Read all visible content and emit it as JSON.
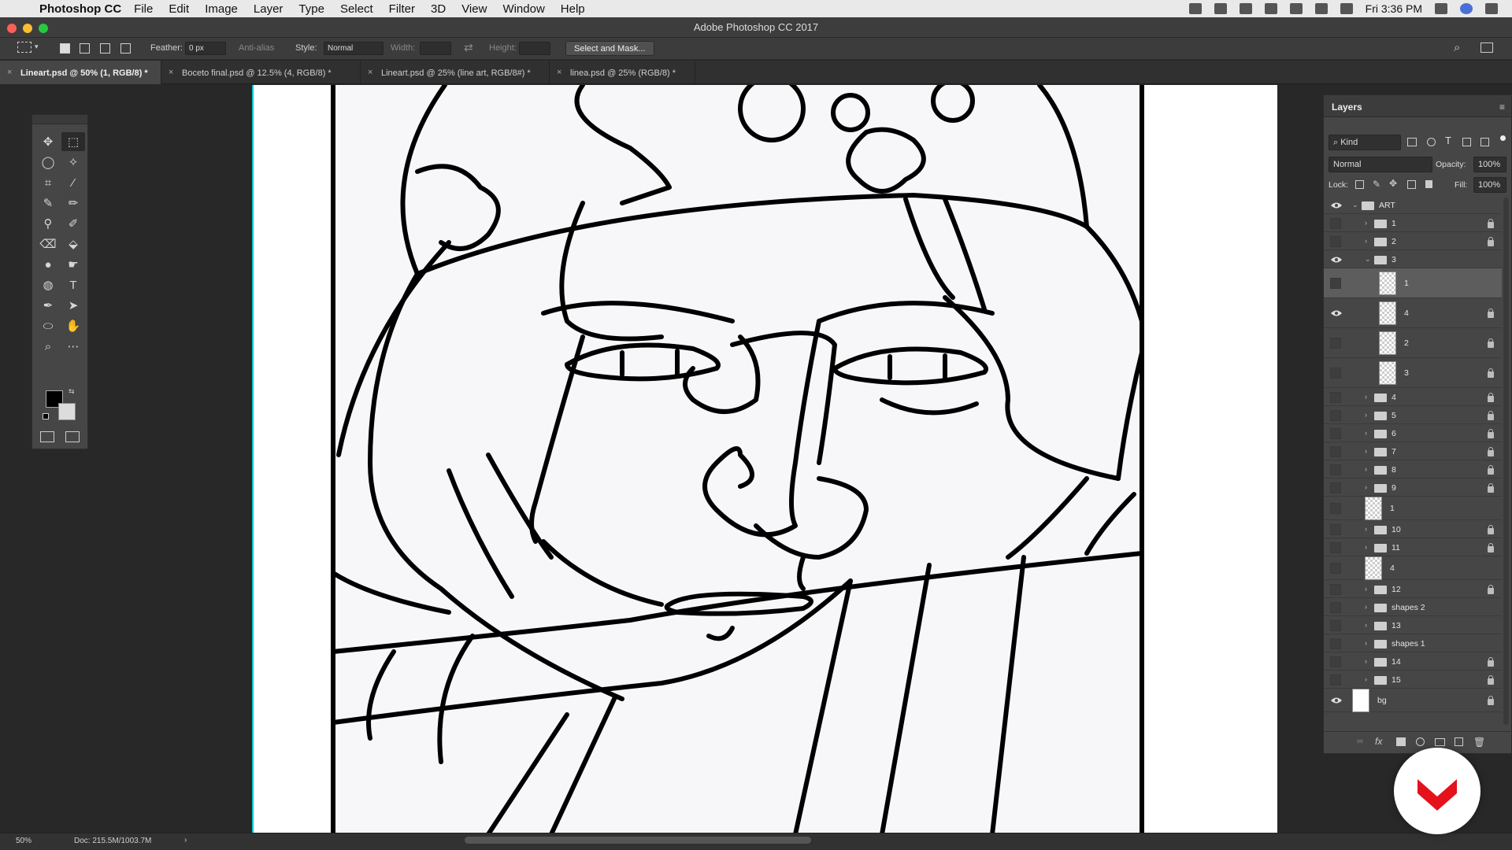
{
  "menubar": {
    "app_name": "Photoshop CC",
    "items": [
      "File",
      "Edit",
      "Image",
      "Layer",
      "Type",
      "Select",
      "Filter",
      "3D",
      "View",
      "Window",
      "Help"
    ],
    "clock": "Fri 3:36 PM"
  },
  "window": {
    "title": "Adobe Photoshop CC 2017"
  },
  "options_bar": {
    "feather_label": "Feather:",
    "feather_value": "0 px",
    "antialias_label": "Anti-alias",
    "style_label": "Style:",
    "style_value": "Normal",
    "width_label": "Width:",
    "height_label": "Height:",
    "select_mask_label": "Select and Mask..."
  },
  "tabs": [
    {
      "label": "Lineart.psd @ 50% (1, RGB/8) *",
      "active": true
    },
    {
      "label": "Boceto final.psd @ 12.5% (4, RGB/8) *",
      "active": false
    },
    {
      "label": "Lineart.psd @ 25% (line art, RGB/8#) *",
      "active": false
    },
    {
      "label": "linea.psd @ 25% (RGB/8) *",
      "active": false
    }
  ],
  "tools": [
    {
      "icon": "move-icon",
      "glyph": "✥"
    },
    {
      "icon": "marquee-icon",
      "glyph": "⬚"
    },
    {
      "icon": "lasso-icon",
      "glyph": "◯"
    },
    {
      "icon": "magic-wand-icon",
      "glyph": "✧"
    },
    {
      "icon": "crop-icon",
      "glyph": "⌗"
    },
    {
      "icon": "eyedropper-icon",
      "glyph": "⁄"
    },
    {
      "icon": "brush-icon",
      "glyph": "✎"
    },
    {
      "icon": "pencil-icon",
      "glyph": "✏"
    },
    {
      "icon": "clone-stamp-icon",
      "glyph": "⚲"
    },
    {
      "icon": "history-brush-icon",
      "glyph": "✐"
    },
    {
      "icon": "eraser-icon",
      "glyph": "⌫"
    },
    {
      "icon": "paint-bucket-icon",
      "glyph": "⬙"
    },
    {
      "icon": "blur-icon",
      "glyph": "●"
    },
    {
      "icon": "smudge-icon",
      "glyph": "☛"
    },
    {
      "icon": "dodge-icon",
      "glyph": "◍"
    },
    {
      "icon": "type-icon",
      "glyph": "T"
    },
    {
      "icon": "pen-icon",
      "glyph": "✒"
    },
    {
      "icon": "path-select-icon",
      "glyph": "➤"
    },
    {
      "icon": "ellipse-icon",
      "glyph": "⬭"
    },
    {
      "icon": "hand-icon",
      "glyph": "✋"
    },
    {
      "icon": "zoom-icon",
      "glyph": "⌕"
    },
    {
      "icon": "more-tools-icon",
      "glyph": "⋯"
    }
  ],
  "layers_panel": {
    "title": "Layers",
    "filter_kind": "Kind",
    "blend_mode": "Normal",
    "opacity_label": "Opacity:",
    "opacity_value": "100%",
    "lock_label": "Lock:",
    "fill_label": "Fill:",
    "fill_value": "100%",
    "layers": [
      {
        "name": "ART",
        "type": "group",
        "indent": 0,
        "expanded": true,
        "visible": true,
        "locked": false
      },
      {
        "name": "1",
        "type": "group",
        "indent": 1,
        "expanded": false,
        "visible": false,
        "locked": true
      },
      {
        "name": "2",
        "type": "group",
        "indent": 1,
        "expanded": false,
        "visible": false,
        "locked": true
      },
      {
        "name": "3",
        "type": "group",
        "indent": 1,
        "expanded": true,
        "visible": true,
        "locked": false
      },
      {
        "name": "1",
        "type": "layer",
        "indent": 2,
        "visible": false,
        "locked": false,
        "selected": true
      },
      {
        "name": "4",
        "type": "layer",
        "indent": 2,
        "visible": true,
        "locked": true
      },
      {
        "name": "2",
        "type": "smart",
        "indent": 2,
        "visible": false,
        "locked": true
      },
      {
        "name": "3",
        "type": "smart",
        "indent": 2,
        "visible": false,
        "locked": true
      },
      {
        "name": "4",
        "type": "group",
        "indent": 1,
        "expanded": false,
        "visible": false,
        "locked": true
      },
      {
        "name": "5",
        "type": "group",
        "indent": 1,
        "expanded": false,
        "visible": false,
        "locked": true
      },
      {
        "name": "6",
        "type": "group",
        "indent": 1,
        "expanded": false,
        "visible": false,
        "locked": true
      },
      {
        "name": "7",
        "type": "group",
        "indent": 1,
        "expanded": false,
        "visible": false,
        "locked": true
      },
      {
        "name": "8",
        "type": "group",
        "indent": 1,
        "expanded": false,
        "visible": false,
        "locked": true
      },
      {
        "name": "9",
        "type": "group",
        "indent": 1,
        "expanded": false,
        "visible": false,
        "locked": true
      },
      {
        "name": "1",
        "type": "smart",
        "indent": 1,
        "visible": false,
        "locked": false
      },
      {
        "name": "10",
        "type": "group",
        "indent": 1,
        "expanded": false,
        "visible": false,
        "locked": true
      },
      {
        "name": "11",
        "type": "group",
        "indent": 1,
        "expanded": false,
        "visible": false,
        "locked": true
      },
      {
        "name": "4",
        "type": "smart",
        "indent": 1,
        "visible": false,
        "locked": false
      },
      {
        "name": "12",
        "type": "group",
        "indent": 1,
        "expanded": false,
        "visible": false,
        "locked": true
      },
      {
        "name": "shapes 2",
        "type": "group",
        "indent": 1,
        "expanded": false,
        "visible": false,
        "locked": false
      },
      {
        "name": "13",
        "type": "group",
        "indent": 1,
        "expanded": false,
        "visible": false,
        "locked": false
      },
      {
        "name": "shapes 1",
        "type": "group",
        "indent": 1,
        "expanded": false,
        "visible": false,
        "locked": false
      },
      {
        "name": "14",
        "type": "group",
        "indent": 1,
        "expanded": false,
        "visible": false,
        "locked": true
      },
      {
        "name": "15",
        "type": "group",
        "indent": 1,
        "expanded": false,
        "visible": false,
        "locked": true
      },
      {
        "name": "bg",
        "type": "fill",
        "indent": 0,
        "visible": true,
        "locked": true
      }
    ]
  },
  "status_bar": {
    "zoom": "50%",
    "doc_info": "Doc: 215.5M/1003.7M"
  },
  "colors": {
    "foreground": "#000000",
    "background": "#dcdcdc",
    "accent": "#00c8d0",
    "logo_red": "#e3121b"
  }
}
